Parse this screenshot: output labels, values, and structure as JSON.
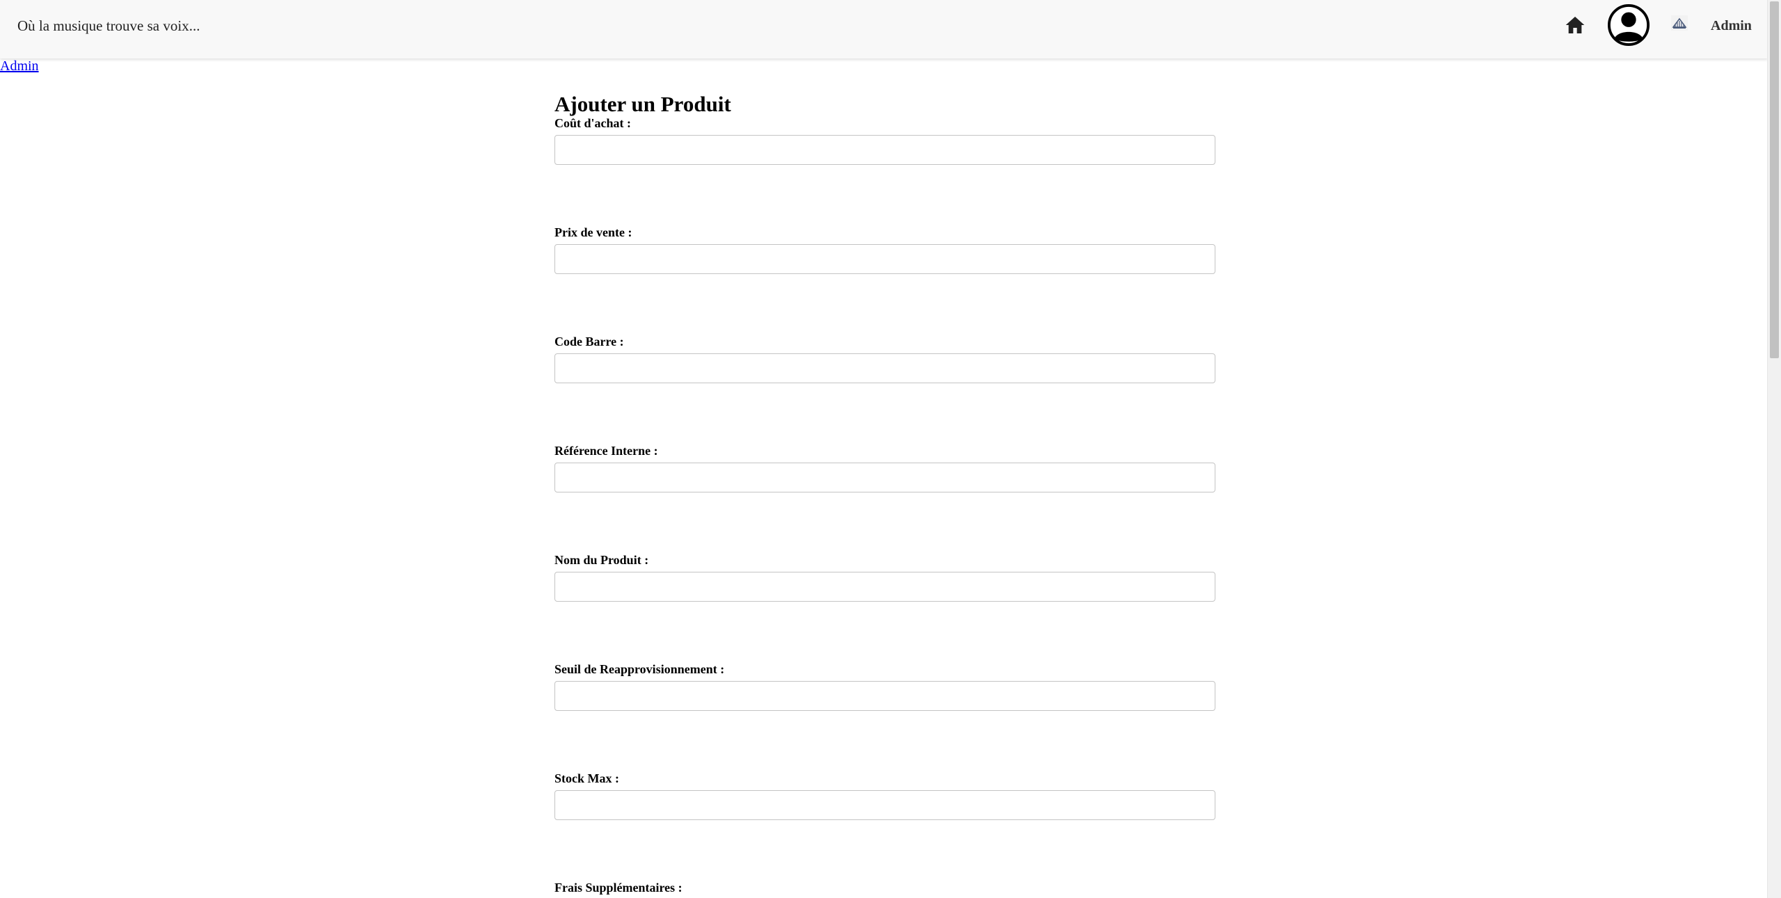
{
  "header": {
    "tagline": "Où la musique trouve sa voix...",
    "user_name": "Admin",
    "icons": [
      "home-icon",
      "user-avatar-icon",
      "logo-icon"
    ]
  },
  "breadcrumb": {
    "admin_link": "Admin"
  },
  "form": {
    "title": "Ajouter un Produit",
    "fields": [
      {
        "label": "Coût d'achat :",
        "value": ""
      },
      {
        "label": "Prix de vente :",
        "value": ""
      },
      {
        "label": "Code Barre :",
        "value": ""
      },
      {
        "label": "Référence Interne :",
        "value": ""
      },
      {
        "label": "Nom du Produit :",
        "value": ""
      },
      {
        "label": "Seuil de Reapprovisionnement :",
        "value": ""
      },
      {
        "label": "Stock Max :",
        "value": ""
      },
      {
        "label": "Frais Supplémentaires :",
        "value": ""
      }
    ]
  }
}
